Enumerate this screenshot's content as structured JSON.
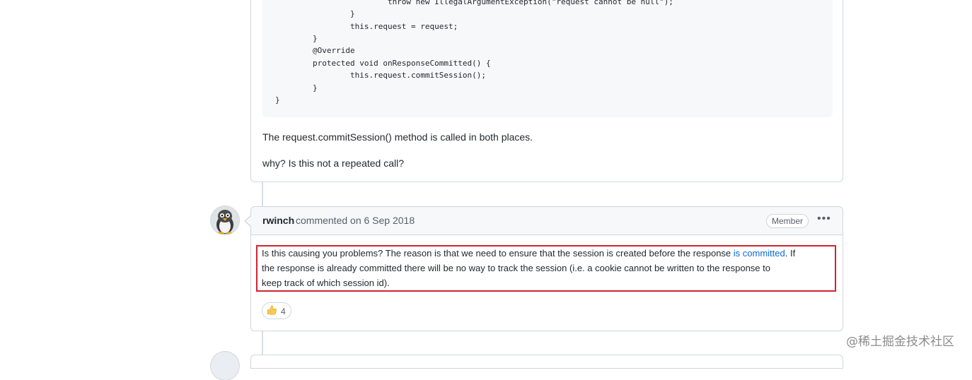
{
  "first_comment": {
    "code_lines": [
      "                        throw new IllegalArgumentException(\"request cannot be null\");",
      "                }",
      "                this.request = request;",
      "        }",
      "        @Override",
      "        protected void onResponseCommitted() {",
      "                this.request.commitSession();",
      "        }",
      "}"
    ],
    "paragraph_1": "The request.commitSession() method is called in both places.",
    "paragraph_2": "why? Is this not a repeated call?"
  },
  "second_comment": {
    "author": "rwinch",
    "meta": "commented on 6 Sep 2018",
    "badge": "Member",
    "menu_icon": "kebab-horizontal-icon",
    "body_line_1_before_link": "Is this causing you problems? The reason is that we need to ensure that the session is created before the response ",
    "body_link": "is committed",
    "body_line_1_after_link": ". If",
    "body_line_2": "the response is already committed there will be no way to track the session (i.e. a cookie cannot be written to the response to",
    "body_line_3": "keep track of which session id).",
    "reaction": {
      "emoji": "thumbs-up",
      "count": "4"
    }
  },
  "watermark": "@稀土掘金技术社区",
  "colors": {
    "border": "#d0d7de",
    "header_bg": "#f6f8fa",
    "link": "#0969da",
    "highlight": "#d1242f"
  }
}
